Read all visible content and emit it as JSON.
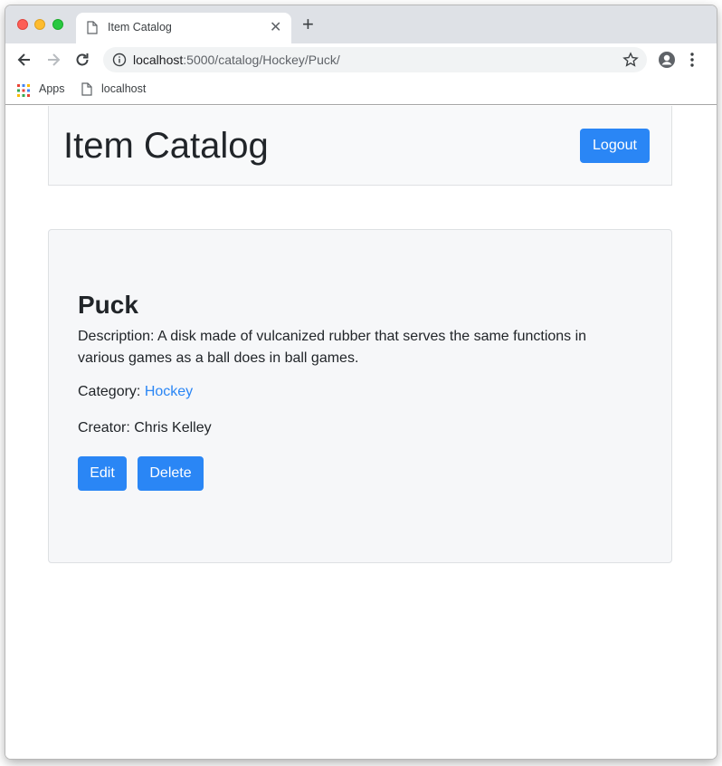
{
  "browser": {
    "tab_title": "Item Catalog",
    "url_host": "localhost",
    "url_rest": ":5000/catalog/Hockey/Puck/",
    "bookmarks": [
      {
        "label": "Apps",
        "icon": "apps-grid-icon"
      },
      {
        "label": "localhost",
        "icon": "page-icon"
      }
    ]
  },
  "header": {
    "brand": "Item Catalog",
    "logout_label": "Logout"
  },
  "item": {
    "name": "Puck",
    "description": "Description: A disk made of vulcanized rubber that serves the same functions in various games as a ball does in ball games.",
    "category_label": "Category: ",
    "category_value": "Hockey",
    "creator": "Creator: Chris Kelley",
    "edit_label": "Edit",
    "delete_label": "Delete"
  },
  "colors": {
    "primary": "#2a86f5",
    "panel_bg": "#f8f9fa",
    "text": "#212529"
  }
}
